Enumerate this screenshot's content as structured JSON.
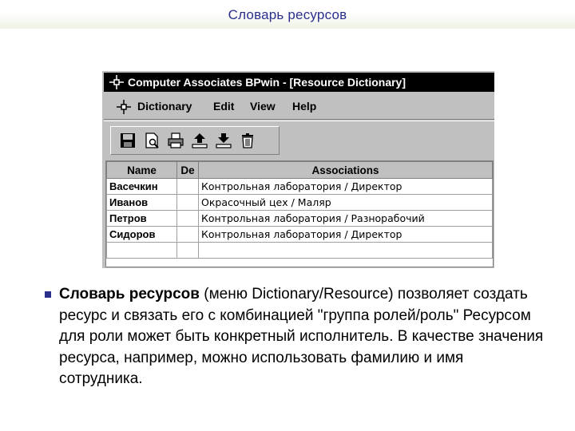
{
  "slide": {
    "title": "Словарь ресурсов"
  },
  "window": {
    "title": "Computer Associates BPwin - [Resource Dictionary]",
    "app_icon": "bpwin-app-icon",
    "menu": [
      {
        "label": "Dictionary"
      },
      {
        "label": "Edit"
      },
      {
        "label": "View"
      },
      {
        "label": "Help"
      }
    ],
    "toolbar_icons": [
      "save-icon",
      "print-preview-icon",
      "print-icon",
      "import-icon",
      "export-icon",
      "delete-icon"
    ],
    "table": {
      "headers": [
        "Name",
        "De",
        "Associations"
      ],
      "rows": [
        {
          "name": "Васечкин",
          "de": "",
          "assoc": "Контрольная лаборатория / Директор"
        },
        {
          "name": "Иванов",
          "de": "",
          "assoc": "Окрасочный цех / Маляр"
        },
        {
          "name": "Петров",
          "de": "",
          "assoc": "Контрольная лаборатория / Разнорабочий"
        },
        {
          "name": "Сидоров",
          "de": "",
          "assoc": "Контрольная лаборатория / Директор"
        },
        {
          "name": "",
          "de": "",
          "assoc": ""
        }
      ]
    }
  },
  "body": {
    "bold_lead": "Словарь ресурсов",
    "text": " (меню Dictionary/Resource) позволяет создать ресурс и связать его с комбинацией \"группа ролей/роль\" Ресурсом для роли может быть конкретный исполнитель. В качестве значения ресурса, например, можно использовать фамилию и имя сотрудника."
  },
  "colors": {
    "accent": "#2a2f8c",
    "titlebar": "#000000",
    "window_face": "#c0c0c0"
  }
}
